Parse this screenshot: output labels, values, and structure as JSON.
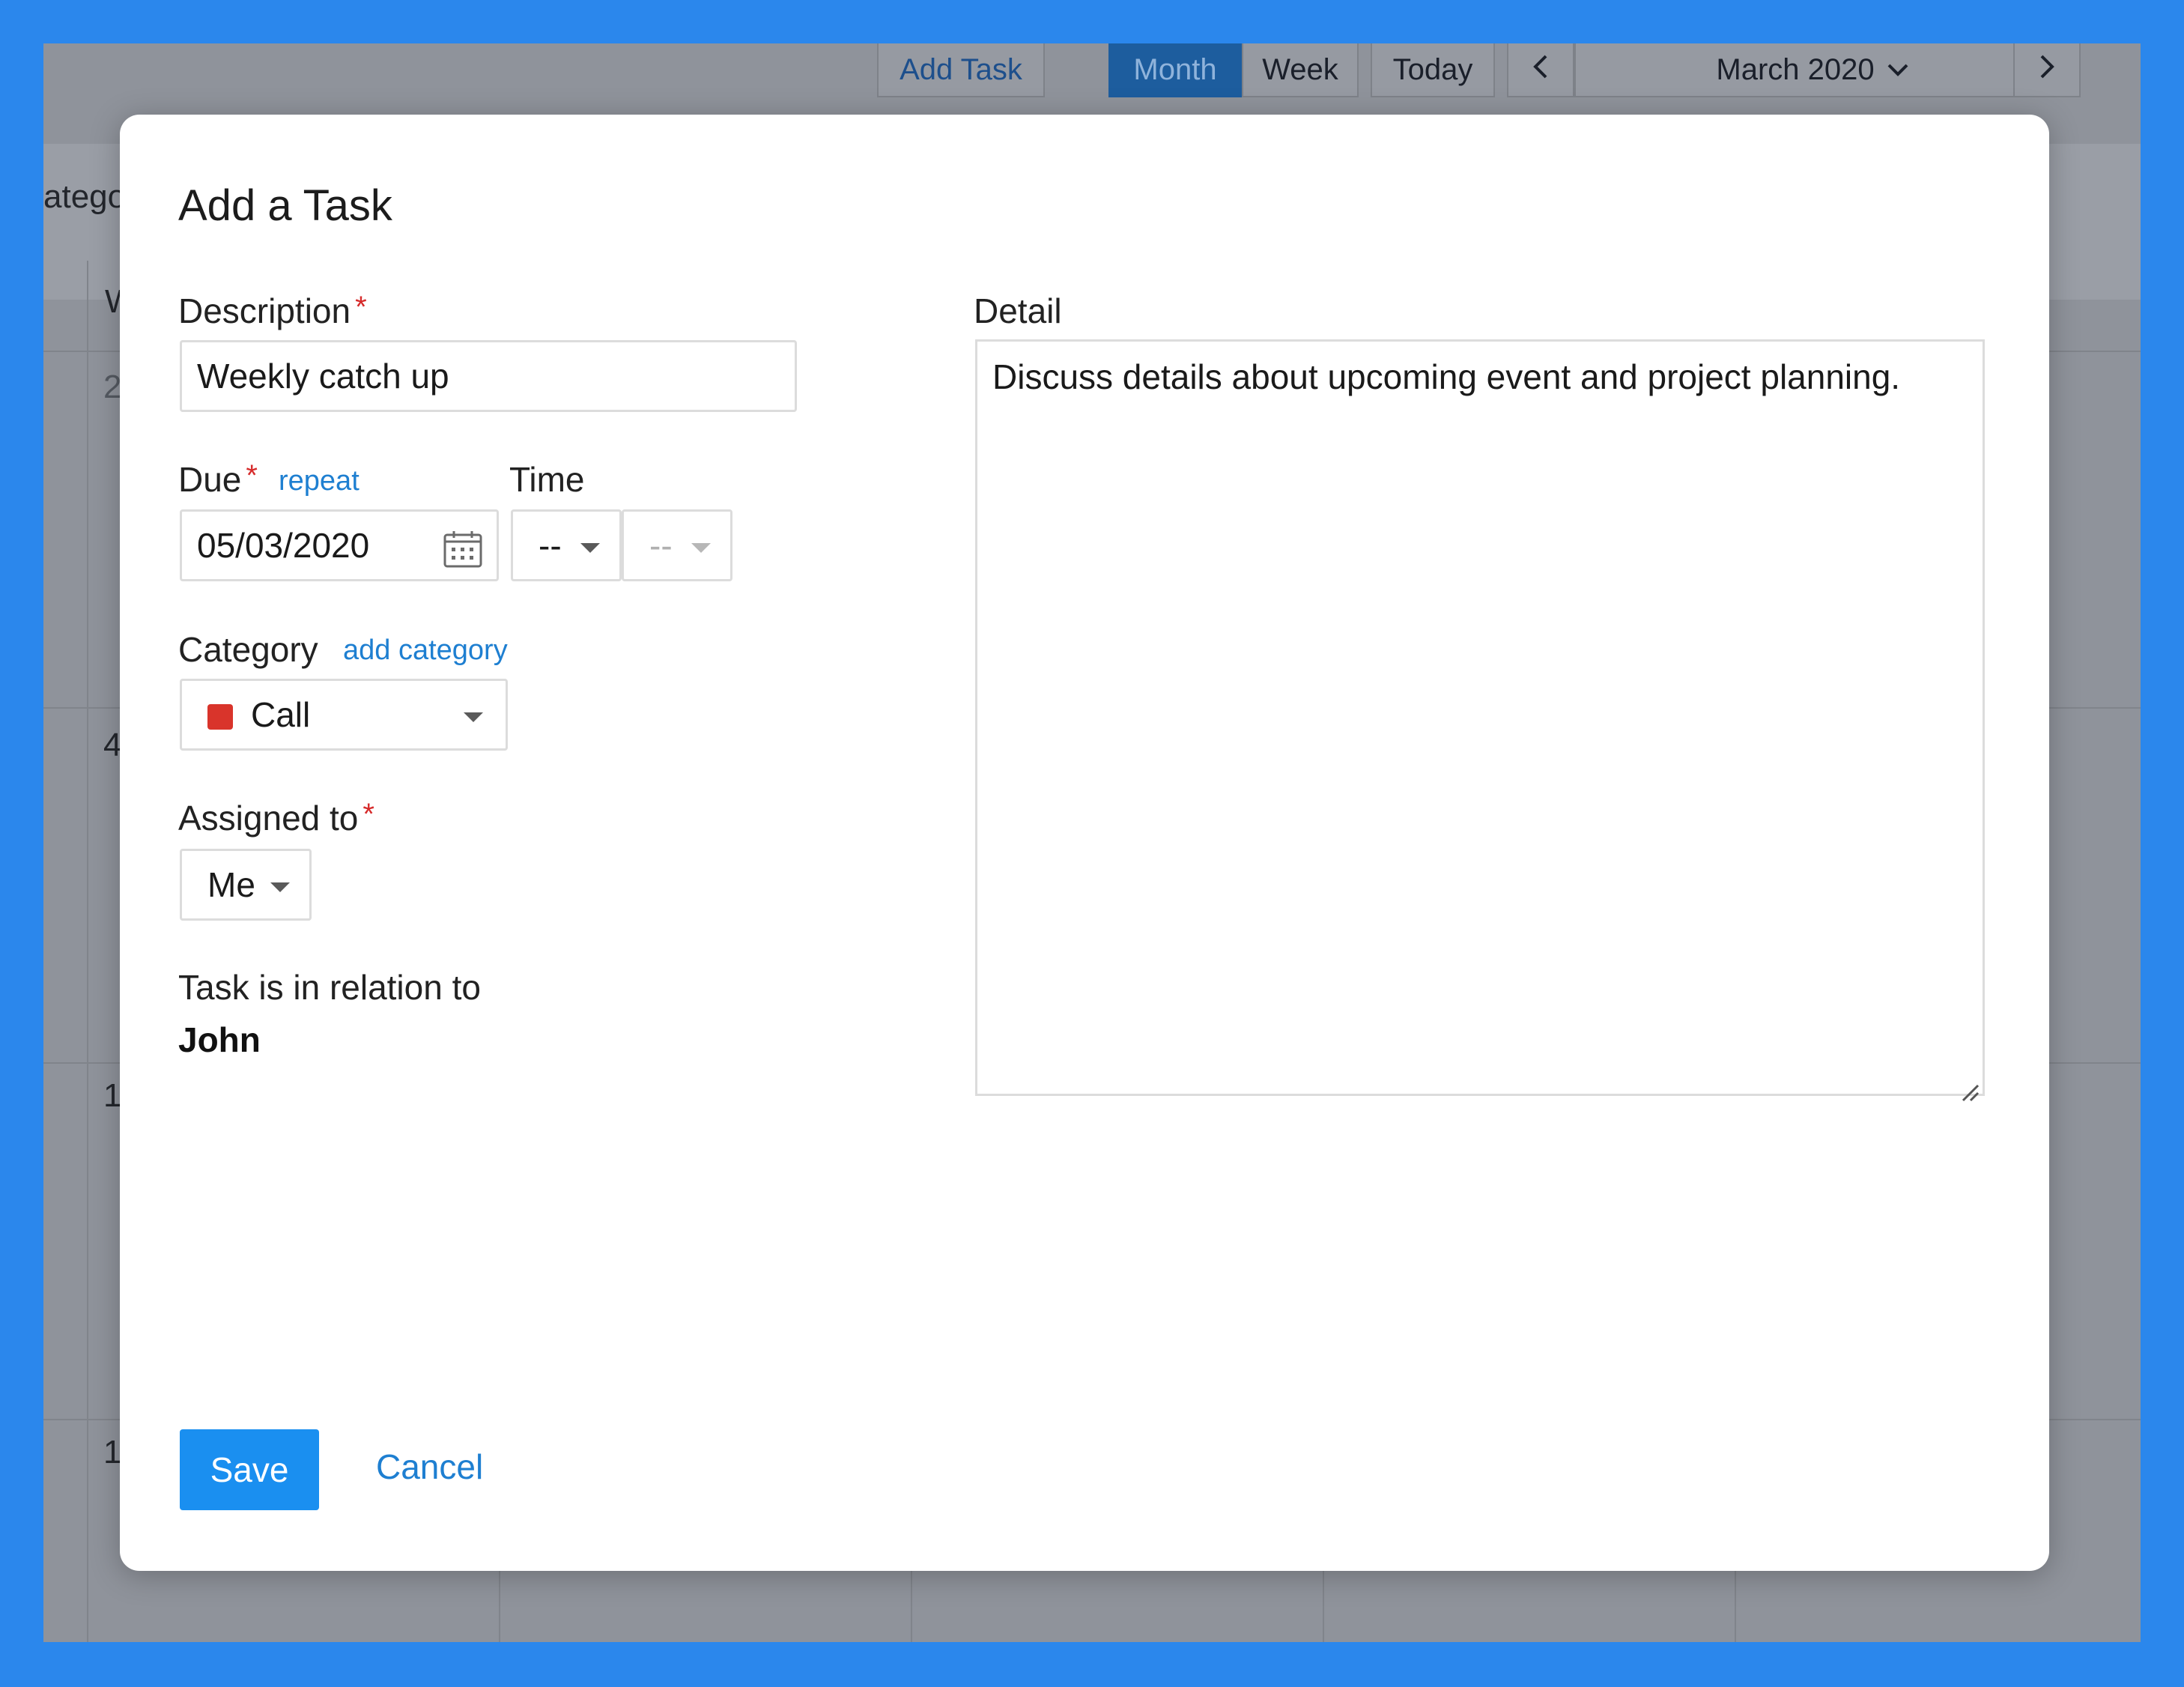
{
  "toolbar": {
    "add_task": "Add Task",
    "month": "Month",
    "week": "Week",
    "today": "Today",
    "prev": "‹",
    "period": "March 2020",
    "next": "›"
  },
  "background": {
    "category_fragment": "atego",
    "row_labels": [
      "W",
      "2",
      "4",
      "1",
      "1"
    ]
  },
  "modal": {
    "title": "Add a Task",
    "description": {
      "label": "Description",
      "required_mark": "*",
      "value": "Weekly catch up"
    },
    "due": {
      "label": "Due",
      "required_mark": "*",
      "repeat_link": "repeat",
      "value": "05/03/2020"
    },
    "time": {
      "label": "Time",
      "hour": "--",
      "minute": "--"
    },
    "category": {
      "label": "Category",
      "add_link": "add category",
      "value": "Call",
      "color": "#d9342b"
    },
    "assigned": {
      "label": "Assigned to",
      "required_mark": "*",
      "value": "Me"
    },
    "relation": {
      "label": "Task is in relation to",
      "value": "John"
    },
    "detail": {
      "label": "Detail",
      "value": "Discuss details about upcoming event and project planning."
    },
    "save_label": "Save",
    "cancel_label": "Cancel"
  },
  "colors": {
    "frame": "#2b87ec",
    "accent": "#1a8ff0",
    "link": "#1e7fd1",
    "required": "#d62b2b"
  }
}
